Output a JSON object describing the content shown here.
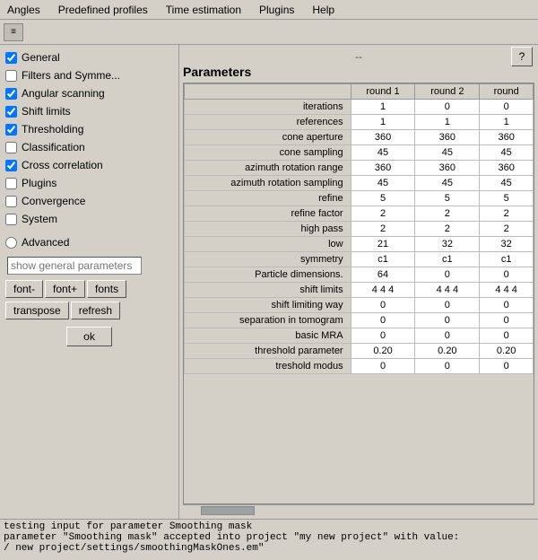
{
  "menubar": {
    "items": [
      "Angles",
      "Predefined profiles",
      "Time estimation",
      "Plugins",
      "Help"
    ]
  },
  "toolbar": {
    "icon_label": "≡"
  },
  "dash": "--",
  "help_btn": "?",
  "params": {
    "title": "Parameters",
    "columns": [
      "round 1",
      "round 2",
      "round"
    ],
    "rows": [
      {
        "label": "iterations",
        "r1": "1",
        "r2": "0",
        "r3": "0"
      },
      {
        "label": "references",
        "r1": "1",
        "r2": "1",
        "r3": "1"
      },
      {
        "label": "cone aperture",
        "r1": "360",
        "r2": "360",
        "r3": "360"
      },
      {
        "label": "cone sampling",
        "r1": "45",
        "r2": "45",
        "r3": "45"
      },
      {
        "label": "azimuth rotation range",
        "r1": "360",
        "r2": "360",
        "r3": "360"
      },
      {
        "label": "azimuth rotation sampling",
        "r1": "45",
        "r2": "45",
        "r3": "45"
      },
      {
        "label": "refine",
        "r1": "5",
        "r2": "5",
        "r3": "5"
      },
      {
        "label": "refine factor",
        "r1": "2",
        "r2": "2",
        "r3": "2"
      },
      {
        "label": "high pass",
        "r1": "2",
        "r2": "2",
        "r3": "2"
      },
      {
        "label": "low",
        "r1": "21",
        "r2": "32",
        "r3": "32"
      },
      {
        "label": "symmetry",
        "r1": "c1",
        "r2": "c1",
        "r3": "c1"
      },
      {
        "label": "Particle dimensions.",
        "r1": "64",
        "r2": "0",
        "r3": "0"
      },
      {
        "label": "shift limits",
        "r1": "4 4 4",
        "r2": "4 4 4",
        "r3": "4 4 4"
      },
      {
        "label": "shift limiting way",
        "r1": "0",
        "r2": "0",
        "r3": "0"
      },
      {
        "label": "separation in tomogram",
        "r1": "0",
        "r2": "0",
        "r3": "0"
      },
      {
        "label": "basic MRA",
        "r1": "0",
        "r2": "0",
        "r3": "0"
      },
      {
        "label": "threshold parameter",
        "r1": "0.20",
        "r2": "0.20",
        "r3": "0.20"
      },
      {
        "label": "treshold modus",
        "r1": "0",
        "r2": "0",
        "r3": "0"
      }
    ]
  },
  "left_panel": {
    "items": [
      {
        "label": "General",
        "checked": true
      },
      {
        "label": "Filters and Symme...",
        "checked": false
      },
      {
        "label": "Angular scanning",
        "checked": true
      },
      {
        "label": "Shift limits",
        "checked": true
      },
      {
        "label": "Thresholding",
        "checked": true
      },
      {
        "label": "Classification",
        "checked": false
      },
      {
        "label": "Cross correlation",
        "checked": true
      },
      {
        "label": "Plugins",
        "checked": false
      },
      {
        "label": "Convergence",
        "checked": false
      },
      {
        "label": "System",
        "checked": false
      }
    ],
    "advanced_label": "Advanced",
    "show_general_placeholder": "show general parameters",
    "font_minus": "font-",
    "font_plus": "font+",
    "fonts": "fonts",
    "transpose": "transpose",
    "refresh": "refresh"
  },
  "ok_label": "ok",
  "log": {
    "line1": "testing input for parameter  Smoothing mask",
    "line2": "parameter \"Smoothing mask\" accepted into project \"my new project\" with value:",
    "line3": "/ new project/settings/smoothingMaskOnes.em\""
  }
}
